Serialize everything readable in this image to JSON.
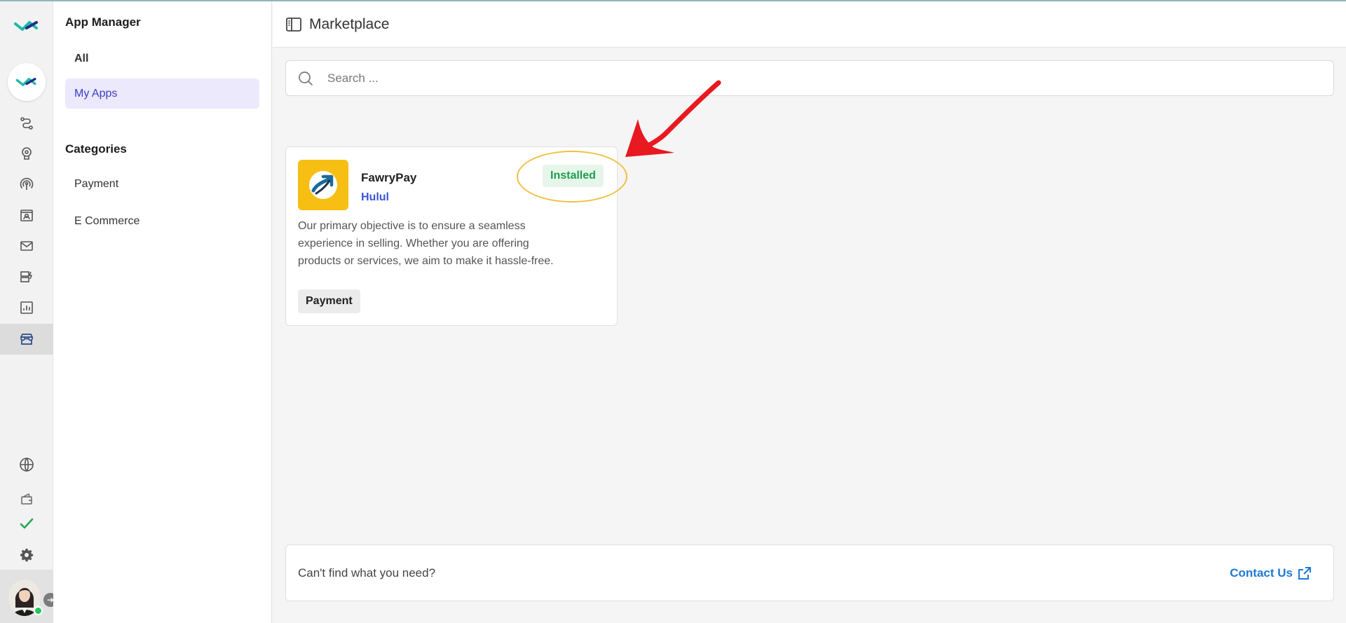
{
  "sidebar": {
    "app_manager_title": "App Manager",
    "items": [
      {
        "label": "All"
      },
      {
        "label": "My Apps"
      }
    ],
    "categories_title": "Categories",
    "categories": [
      {
        "label": "Payment"
      },
      {
        "label": "E Commerce"
      }
    ]
  },
  "header": {
    "title": "Marketplace"
  },
  "search": {
    "placeholder": "Search ..."
  },
  "apps": [
    {
      "name": "FawryPay",
      "vendor": "Hulul",
      "status": "Installed",
      "description_lines": [
        "Our primary objective is to ensure a seamless",
        "experience in selling. Whether you are offering",
        "products or services, we aim to make it hassle-free."
      ],
      "tag": "Payment"
    }
  ],
  "footer": {
    "help_text": "Can't find what you need?",
    "contact_label": "Contact Us"
  },
  "colors": {
    "accent": "#3b3dc2",
    "installed": "#1f9d4f",
    "link": "#1f7ad6",
    "annotation_arrow": "#e8191f",
    "annotation_ring": "#f0c040"
  }
}
